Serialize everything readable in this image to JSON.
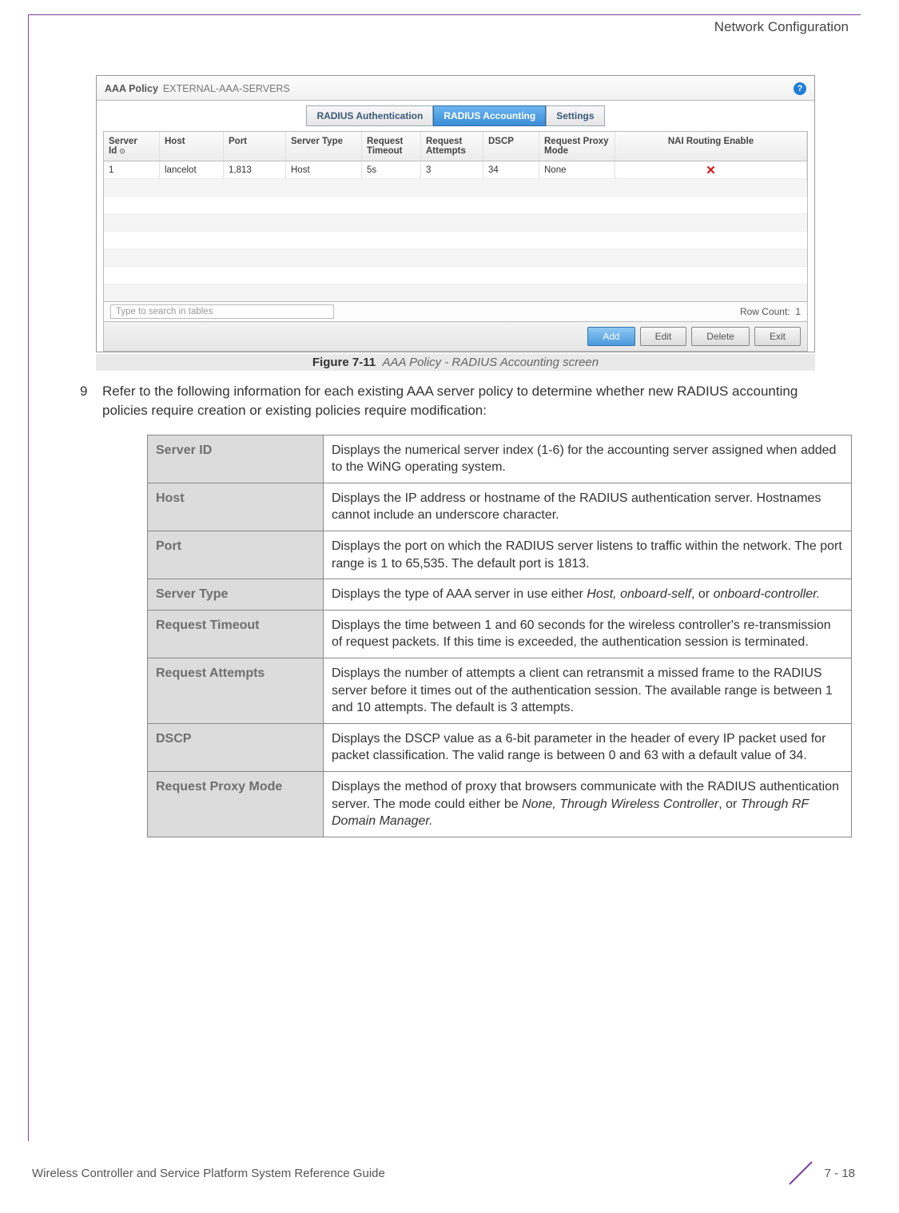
{
  "header": {
    "section": "Network Configuration"
  },
  "screenshot": {
    "policy_label": "AAA Policy",
    "policy_value": "EXTERNAL-AAA-SERVERS",
    "help_glyph": "?",
    "tabs": [
      {
        "label": "RADIUS Authentication",
        "active": false
      },
      {
        "label": "RADIUS Accounting",
        "active": true
      },
      {
        "label": "Settings",
        "active": false
      }
    ],
    "columns": [
      "Server Id",
      "Host",
      "Port",
      "Server Type",
      "Request Timeout",
      "Request Attempts",
      "DSCP",
      "Request Proxy Mode",
      "NAI Routing Enable"
    ],
    "sort_indicator": "⊙",
    "row": {
      "server_id": "1",
      "host": "lancelot",
      "port": "1,813",
      "server_type": "Host",
      "timeout": "5s",
      "attempts": "3",
      "dscp": "34",
      "proxy": "None",
      "nai": "✕"
    },
    "search_placeholder": "Type to search in tables",
    "row_count_label": "Row Count:",
    "row_count_value": "1",
    "buttons": {
      "add": "Add",
      "edit": "Edit",
      "delete": "Delete",
      "exit": "Exit"
    }
  },
  "figure": {
    "label": "Figure 7-11",
    "caption": "AAA Policy - RADIUS Accounting screen"
  },
  "step": {
    "num": "9",
    "text": "Refer to the following information for each existing AAA server policy to determine whether new RADIUS accounting policies require creation or existing policies require modification:"
  },
  "defs": [
    {
      "k": "Server ID",
      "v": "Displays the numerical server index (1-6) for the accounting server assigned when added to the WiNG operating system."
    },
    {
      "k": "Host",
      "v": "Displays the IP address or hostname of the RADIUS authentication server. Hostnames cannot include an underscore character."
    },
    {
      "k": "Port",
      "v": "Displays the port on which the RADIUS server listens to traffic within the network. The port range is 1 to 65,535. The default port is 1813."
    },
    {
      "k": "Server Type",
      "v_pre": "Displays the type of AAA server in use either ",
      "v_em": "Host, onboard-self",
      "v_mid": ", or ",
      "v_em2": "onboard-controller."
    },
    {
      "k": "Request Timeout",
      "v": "Displays the time between 1 and 60 seconds for the wireless controller's re-transmission of request packets. If this time is exceeded, the authentication session is terminated."
    },
    {
      "k": "Request Attempts",
      "v": "Displays the number of attempts a client can retransmit a missed frame to the RADIUS server before it times out of the authentication session. The available range is between 1 and 10 attempts. The default is 3 attempts."
    },
    {
      "k": "DSCP",
      "v": "Displays the DSCP value as a 6-bit parameter in the header of every IP packet used for packet classification. The valid range is between 0 and 63 with a default value of 34."
    },
    {
      "k": "Request Proxy Mode",
      "v_pre": "Displays the method of proxy that browsers communicate with the RADIUS authentication server. The mode could either be ",
      "v_em": "None, Through Wireless Controller",
      "v_mid": ", or ",
      "v_em2": "Through RF Domain Manager."
    }
  ],
  "footer": {
    "doc": "Wireless Controller and Service Platform System Reference Guide",
    "page": "7 - 18"
  }
}
